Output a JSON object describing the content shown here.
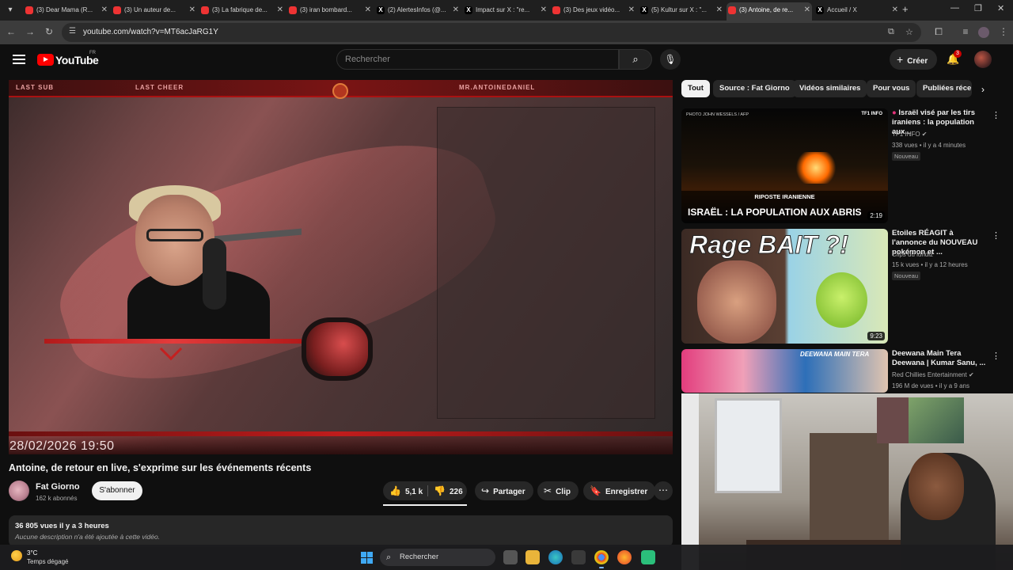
{
  "browser": {
    "tabs": [
      {
        "label": "(3) Dear Mama (R...",
        "favicon": "youtube-icon"
      },
      {
        "label": "(3) Un auteur de...",
        "favicon": "youtube-icon"
      },
      {
        "label": "(3) La fabrique de...",
        "favicon": "youtube-icon"
      },
      {
        "label": "(3) iran bombard...",
        "favicon": "youtube-icon"
      },
      {
        "label": "(2) AlertesInfos (@...",
        "favicon": "x-icon"
      },
      {
        "label": "Impact sur X : \"re...",
        "favicon": "x-icon"
      },
      {
        "label": "(3) Des jeux vidéo...",
        "favicon": "youtube-icon"
      },
      {
        "label": "(5) Kultur sur X : \"...",
        "favicon": "x-icon"
      },
      {
        "label": "(3) Antoine, de re...",
        "favicon": "youtube-icon",
        "active": true
      },
      {
        "label": "Accueil / X",
        "favicon": "x-icon"
      }
    ],
    "url": "youtube.com/watch?v=MT6acJaRG1Y"
  },
  "youtube_header": {
    "logo": "YouTube",
    "country_code": "FR",
    "search_placeholder": "Rechercher",
    "create_label": "Créer",
    "notification_count": "3"
  },
  "player": {
    "overlay_labels": [
      "LAST SUB",
      "LAST CHEER",
      "MR.ANTOINEDANIEL"
    ],
    "timestamp": "28/02/2026   19:50"
  },
  "video": {
    "title": "Antoine, de retour en live, s'exprime sur les événements récents",
    "channel": "Fat Giorno",
    "subscribers": "162 k abonnés",
    "subscribe_label": "S'abonner",
    "likes": "5,1 k",
    "dislikes": "226",
    "share_label": "Partager",
    "clip_label": "Clip",
    "save_label": "Enregistrer",
    "views_date": "36 805 vues  il y a 3 heures",
    "description": "Aucune description n'a été ajoutée à cette vidéo."
  },
  "chips": [
    "Tout",
    "Source : Fat Giorno",
    "Vidéos similaires",
    "Pour vous",
    "Publiées réce"
  ],
  "recommendations": [
    {
      "title": "Israël visé par les tirs iraniens : la population aux...",
      "channel": "TF1 INFO",
      "meta": "338 vues • il y a 4 minutes",
      "badge": "Nouveau",
      "duration": "2:19",
      "thumb_subtitle": "RIPOSTE IRANIENNE",
      "thumb_headline": "ISRAËL : LA POPULATION AUX ABRIS",
      "thumb_credit": "PHOTO JOHN WESSELS / AFP",
      "thumb_brand": "TF1 INFO"
    },
    {
      "title": "Etoiles RÉAGIT à l'annonce du NOUVEAU pokémon et ...",
      "channel": "Clips du lundiz",
      "meta": "15 k vues • il y a 12 heures",
      "badge": "Nouveau",
      "duration": "9:23",
      "thumb_text": "Rage BAIT ?!"
    },
    {
      "title": "Deewana Main Tera Deewana | Kumar Sanu, ...",
      "channel": "Red Chillies Entertainment",
      "meta": "196 M de vues • il y a 9 ans",
      "thumb_banner": "DEEWANA MAIN TERA"
    }
  ],
  "taskbar": {
    "temperature": "3°C",
    "weather": "Temps dégagé",
    "search_label": "Rechercher"
  },
  "colors": {
    "youtube_red": "#ff0000",
    "background": "#0f0f0f",
    "overlay_red": "#b21a1a"
  }
}
